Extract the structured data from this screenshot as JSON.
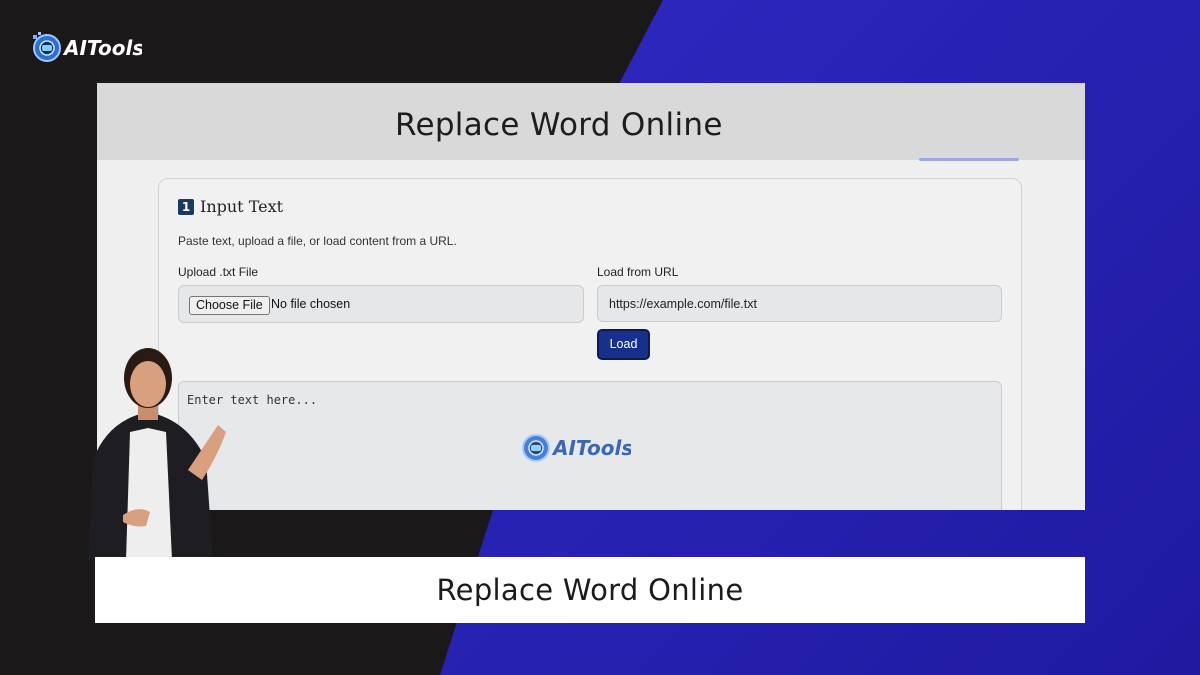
{
  "brand": {
    "logo_text": "AITools",
    "logo_icon": "gear-robot-icon"
  },
  "screenshot": {
    "title": "Replace Word Online",
    "section": {
      "number": "1",
      "title": "Input Text",
      "description": "Paste text, upload a file, or load content from a URL."
    },
    "upload": {
      "label": "Upload .txt File",
      "button_label": "Choose File",
      "status": "No file chosen"
    },
    "url_loader": {
      "label": "Load from URL",
      "value": "https://example.com/file.txt",
      "button_label": "Load"
    },
    "textarea": {
      "placeholder": "Enter text here..."
    },
    "watermark_text": "AITools"
  },
  "caption": "Replace Word Online",
  "colors": {
    "accent_blue": "#2f2ad0",
    "button_blue": "#17308e",
    "badge_navy": "#1b3a63"
  }
}
